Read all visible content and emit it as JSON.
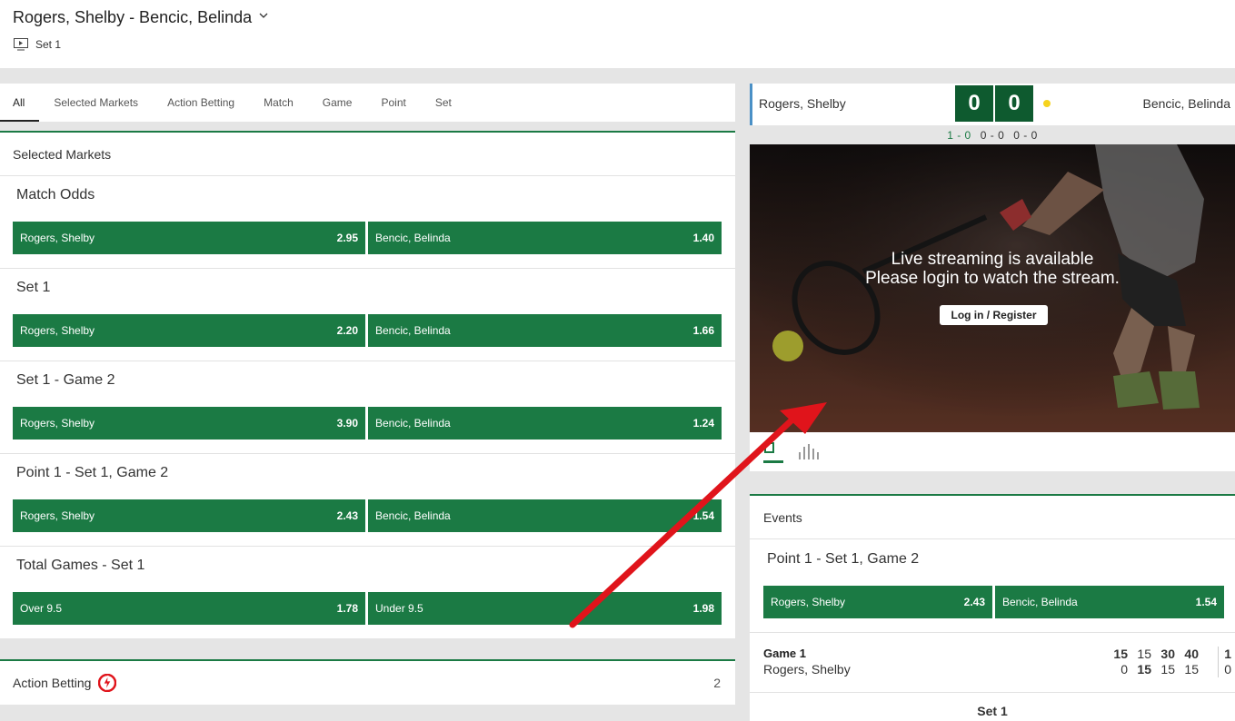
{
  "header": {
    "match_title": "Rogers, Shelby - Bencic, Belinda",
    "set_label": "Set 1"
  },
  "tabs": [
    {
      "label": "All",
      "active": true
    },
    {
      "label": "Selected Markets"
    },
    {
      "label": "Action Betting"
    },
    {
      "label": "Match"
    },
    {
      "label": "Game"
    },
    {
      "label": "Point"
    },
    {
      "label": "Set"
    }
  ],
  "selected_markets": {
    "heading": "Selected Markets",
    "markets": [
      {
        "title": "Match Odds",
        "left": {
          "label": "Rogers, Shelby",
          "price": "2.95"
        },
        "right": {
          "label": "Bencic, Belinda",
          "price": "1.40"
        }
      },
      {
        "title": "Set 1",
        "left": {
          "label": "Rogers, Shelby",
          "price": "2.20"
        },
        "right": {
          "label": "Bencic, Belinda",
          "price": "1.66"
        }
      },
      {
        "title": "Set 1 - Game 2",
        "left": {
          "label": "Rogers, Shelby",
          "price": "3.90"
        },
        "right": {
          "label": "Bencic, Belinda",
          "price": "1.24"
        }
      },
      {
        "title": "Point 1 - Set 1, Game 2",
        "left": {
          "label": "Rogers, Shelby",
          "price": "2.43"
        },
        "right": {
          "label": "Bencic, Belinda",
          "price": "1.54"
        }
      },
      {
        "title": "Total Games - Set 1",
        "left": {
          "label": "Over 9.5",
          "price": "1.78"
        },
        "right": {
          "label": "Under 9.5",
          "price": "1.98"
        }
      }
    ]
  },
  "action_betting": {
    "label": "Action Betting",
    "count": "2"
  },
  "scoreboard": {
    "player1": "Rogers, Shelby",
    "player2": "Bencic, Belinda",
    "score1": "0",
    "score2": "0",
    "sets": [
      "1 - 0",
      "0 - 0",
      "0 - 0"
    ]
  },
  "stream": {
    "line1": "Live streaming is available",
    "line2": "Please login to watch the stream.",
    "login_label": "Log in / Register"
  },
  "events": {
    "heading": "Events",
    "market": {
      "title": "Point 1 - Set 1, Game 2",
      "left": {
        "label": "Rogers, Shelby",
        "price": "2.43"
      },
      "right": {
        "label": "Bencic, Belinda",
        "price": "1.54"
      }
    },
    "game": {
      "label": "Game 1",
      "player": "Rogers, Shelby",
      "row1": [
        "15",
        "15",
        "30",
        "40"
      ],
      "row2": [
        "0",
        "15",
        "15",
        "15"
      ],
      "set_a": "1",
      "set_b": "0"
    },
    "footer": "Set 1"
  },
  "colors": {
    "accent": "#1b7a44",
    "score_box": "#0e5a2f",
    "serve": "#f6d31e",
    "annotation": "#e0141b"
  }
}
